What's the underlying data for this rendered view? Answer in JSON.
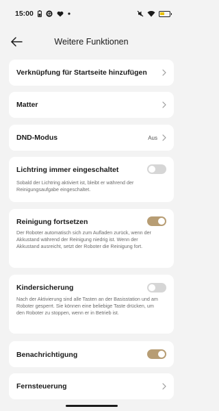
{
  "status_bar": {
    "time": "15:00",
    "icons_left": [
      "battery-saver-icon",
      "g-app-icon",
      "heart-icon",
      "dot-icon"
    ],
    "icons_right": [
      "mute-icon",
      "wifi-icon",
      "battery-icon"
    ]
  },
  "header": {
    "title": "Weitere Funktionen",
    "back_icon": "arrow-left-icon"
  },
  "items": {
    "homescreen_link": {
      "title": "Verknüpfung für Startseite hinzufügen"
    },
    "matter": {
      "title": "Matter"
    },
    "dnd": {
      "title": "DND-Modus",
      "value": "Aus"
    },
    "light_ring": {
      "title": "Lichtring immer eingeschaltet",
      "description": "Sobald der Lichtring aktiviert ist, bleibt er während der Reinigungsaufgabe eingeschaltet.",
      "enabled": false
    },
    "resume_cleaning": {
      "title": "Reinigung fortsetzen",
      "description": "Der Roboter automatisch sich zum Aufladen zurück, wenn der Akkustand während der Reinigung niedrig ist. Wenn der Akkustand ausreicht, setzt der Roboter die Reinigung fort.",
      "enabled": true
    },
    "child_lock": {
      "title": "Kindersicherung",
      "description": "Nach der Aktivierung sind alle Tasten an der Basisstation und am Roboter gesperrt. Sie können eine beliebige Taste drücken, um den Roboter zu stoppen, wenn er in Betrieb ist.",
      "enabled": false
    },
    "notification": {
      "title": "Benachrichtigung",
      "enabled": true
    },
    "remote": {
      "title": "Fernsteuerung"
    }
  },
  "colors": {
    "toggle_on": "#b79d74",
    "toggle_off": "#d6d6d6",
    "background": "#f3f3f3",
    "card": "#ffffff"
  }
}
